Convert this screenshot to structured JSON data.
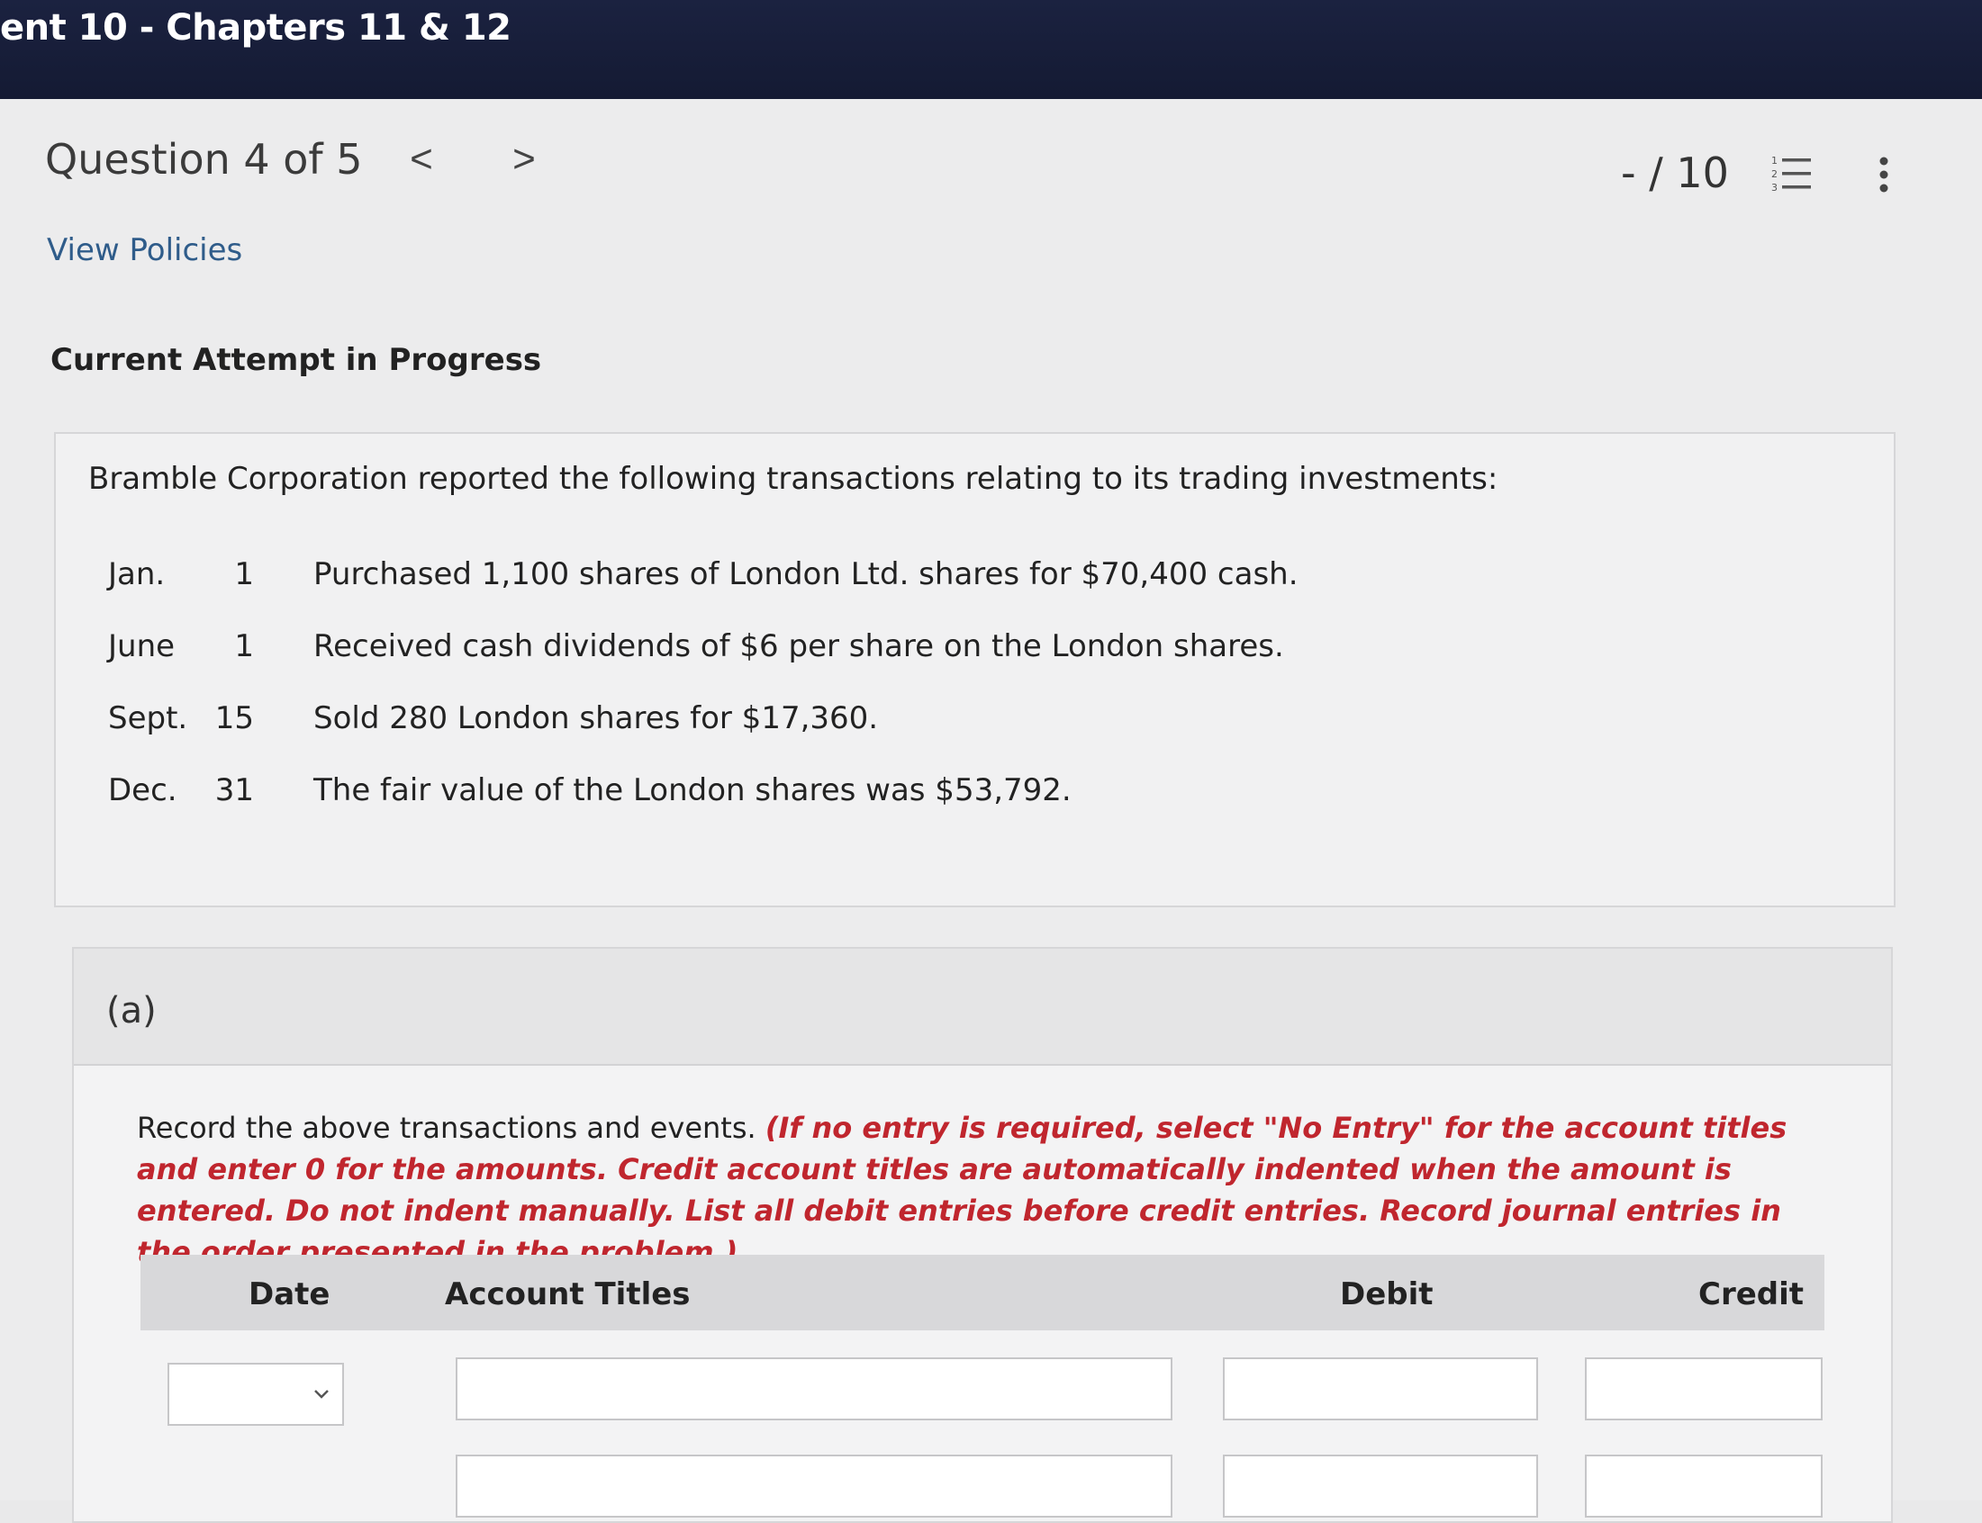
{
  "topbar": {
    "title": "ent 10 - Chapters 11 & 12"
  },
  "question_nav": {
    "title": "Question 4 of 5",
    "prev_icon": "chevron-left-icon",
    "next_icon": "chevron-right-icon",
    "prev_glyph": "<",
    "next_glyph": ">"
  },
  "score": {
    "text": "- / 10"
  },
  "toolbar": {
    "list_icon": "numbered-list-icon",
    "more_icon": "more-vertical-icon"
  },
  "links": {
    "view_policies": "View Policies"
  },
  "attempt": {
    "heading": "Current Attempt in Progress"
  },
  "problem": {
    "intro": "Bramble Corporation reported the following transactions relating to its trading investments:",
    "transactions": [
      {
        "month": "Jan.",
        "day": "1",
        "description": "Purchased 1,100 shares of London Ltd. shares for $70,400 cash."
      },
      {
        "month": "June",
        "day": "1",
        "description": "Received cash dividends of $6 per share on the London shares."
      },
      {
        "month": "Sept.",
        "day": "15",
        "description": "Sold 280 London shares for $17,360."
      },
      {
        "month": "Dec.",
        "day": "31",
        "description": "The fair value of the London shares was $53,792."
      }
    ]
  },
  "part_a": {
    "label": "(a)",
    "instruction_plain": "Record the above transactions and events. ",
    "instruction_red": "(If no entry is required, select \"No Entry\" for the account titles and enter 0 for the amounts. Credit account titles are automatically indented when the amount is entered. Do not indent manually. List all debit entries before credit entries. Record journal entries in the order presented in the problem.)",
    "table": {
      "columns": [
        "Date",
        "Account Titles",
        "Debit",
        "Credit"
      ],
      "rows": [
        {
          "date": "",
          "account": "",
          "debit": "",
          "credit": ""
        },
        {
          "account": "",
          "debit": "",
          "credit": ""
        }
      ]
    }
  },
  "colors": {
    "topbar": "#1b2240",
    "link": "#2f5c8a",
    "instruction_red": "#c0262e"
  }
}
